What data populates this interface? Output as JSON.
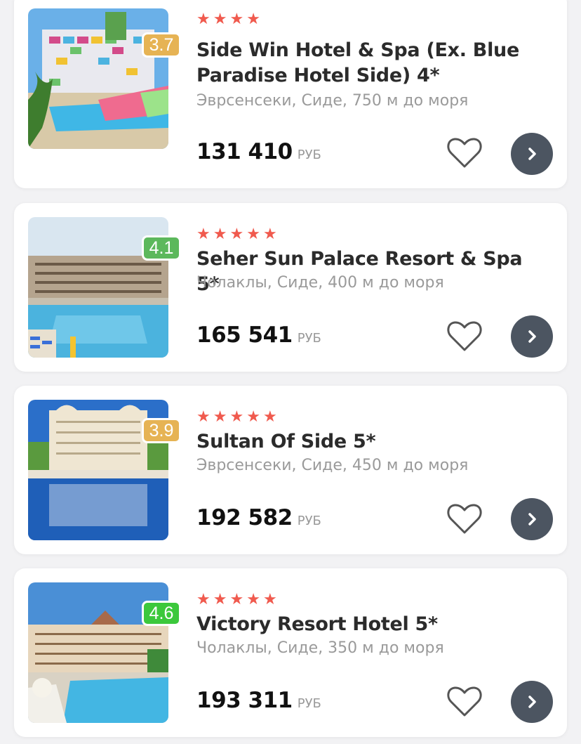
{
  "colors": {
    "star": "#f05a4e",
    "rating_mid": "#e6b354",
    "rating_good": "#5cb85c",
    "rating_best": "#3cc83c",
    "arrow_button": "#4c5561"
  },
  "hotels": [
    {
      "stars": 4,
      "rating": "3.7",
      "rating_color": "#e6b354",
      "name": "Side Win Hotel & Spa (Ex. Blue Paradise Hotel Side) 4*",
      "location": "Эврсенсеки, Сиде, 750 м до моря",
      "price": "131 410",
      "currency": "РУБ",
      "photo_icon": "hotel-photo-colorful-facade-pool",
      "favorite_icon": "heart-outline-icon",
      "open_icon": "chevron-right-icon"
    },
    {
      "stars": 5,
      "rating": "4.1",
      "rating_color": "#5cb85c",
      "name": "Seher Sun Palace Resort & Spa 5*",
      "location": "Чолаклы, Сиде, 400 м до моря",
      "price": "165 541",
      "currency": "РУБ",
      "photo_icon": "hotel-photo-pool-sunbeds",
      "favorite_icon": "heart-outline-icon",
      "open_icon": "chevron-right-icon"
    },
    {
      "stars": 5,
      "rating": "3.9",
      "rating_color": "#e6b354",
      "name": "Sultan Of Side 5*",
      "location": "Эврсенсеки, Сиде, 450 м до моря",
      "price": "192 582",
      "currency": "РУБ",
      "photo_icon": "hotel-photo-reflection-pool",
      "favorite_icon": "heart-outline-icon",
      "open_icon": "chevron-right-icon"
    },
    {
      "stars": 5,
      "rating": "4.6",
      "rating_color": "#3cc83c",
      "name": "Victory Resort Hotel 5*",
      "location": "Чолаклы, Сиде, 350 м до моря",
      "price": "193 311",
      "currency": "РУБ",
      "photo_icon": "hotel-photo-resort-pool",
      "favorite_icon": "heart-outline-icon",
      "open_icon": "chevron-right-icon"
    }
  ]
}
